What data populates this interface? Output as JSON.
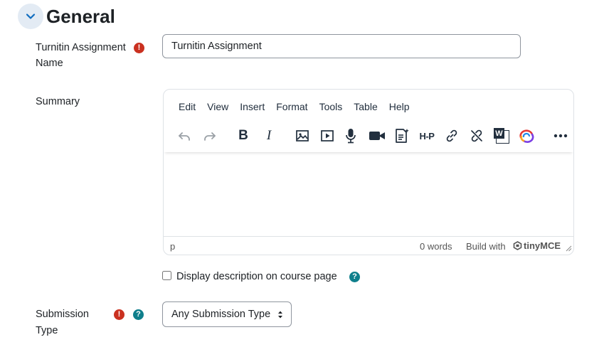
{
  "section": {
    "title": "General"
  },
  "fields": {
    "name": {
      "label_line1": "Turnitin Assignment",
      "label_line2": "Name",
      "value": "Turnitin Assignment"
    },
    "summary": {
      "label": "Summary"
    },
    "display_description": {
      "label": "Display description on course page",
      "checked": false
    },
    "submission_type": {
      "label_line1": "Submission",
      "label_line2": "Type",
      "selected": "Any Submission Type"
    }
  },
  "editor": {
    "menu": [
      "Edit",
      "View",
      "Insert",
      "Format",
      "Tools",
      "Table",
      "Help"
    ],
    "toolbar_icons": [
      "undo-icon",
      "redo-icon",
      "bold-icon",
      "italic-icon",
      "image-icon",
      "media-icon",
      "microphone-icon",
      "video-camera-icon",
      "content-bank-icon",
      "h5p-icon",
      "link-icon",
      "unlink-icon",
      "word-import-icon",
      "plugin-swirl-icon",
      "more-icon"
    ],
    "toolbar_text": {
      "bold": "B",
      "italic": "I",
      "h5p": "H-P",
      "word": "W"
    },
    "status": {
      "path": "p",
      "words": "0 words",
      "build_with": "Build with",
      "brand": "tinyMCE"
    }
  },
  "icons": {
    "required": "!",
    "help": "?"
  },
  "colors": {
    "required": "#ca3120",
    "help": "#0f7f8c",
    "collapse_bg": "#e3ebf4",
    "collapse_chevron": "#0f6cbf"
  }
}
